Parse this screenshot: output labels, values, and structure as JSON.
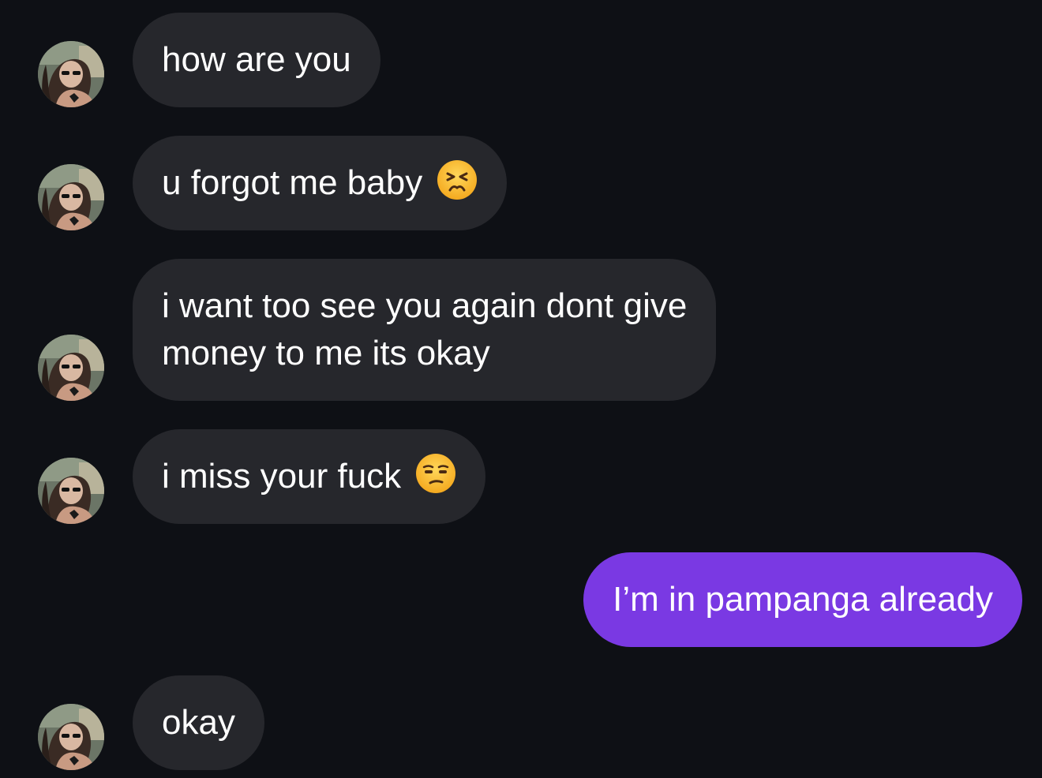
{
  "conversation": {
    "messages": [
      {
        "sender": "contact",
        "text": "how are you"
      },
      {
        "sender": "contact",
        "text": "u forgot me baby",
        "emoji": "persevering-face-emoji"
      },
      {
        "sender": "contact",
        "lines": [
          "i want too see you again dont give",
          "money to me its okay"
        ]
      },
      {
        "sender": "contact",
        "text": "i miss your fuck",
        "emoji": "unamused-face-emoji"
      },
      {
        "sender": "self",
        "text": "I’m in pampanga already"
      },
      {
        "sender": "contact",
        "text": "okay"
      }
    ]
  },
  "colors": {
    "background": "#0e1015",
    "incoming_bubble": "#26272c",
    "outgoing_bubble": "#7a39e3",
    "text": "#ffffff"
  },
  "icons": {
    "avatar": "contact-avatar-photo"
  }
}
